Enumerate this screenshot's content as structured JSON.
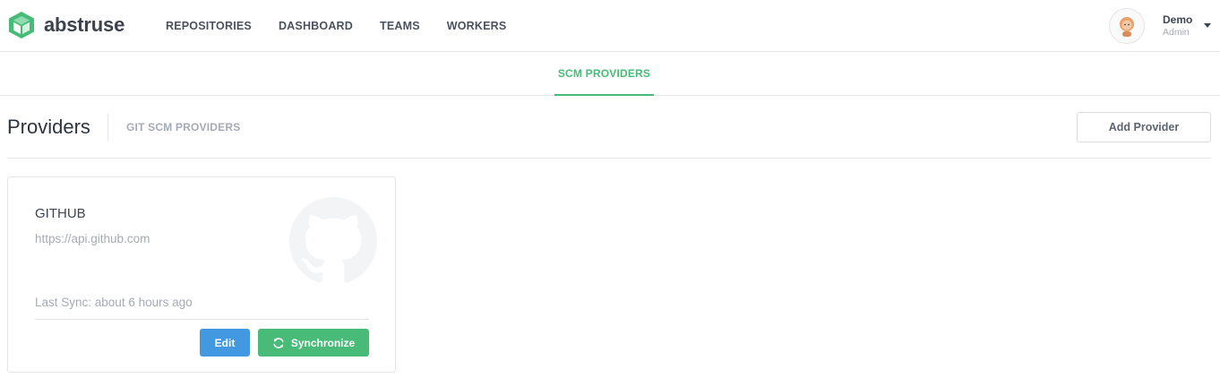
{
  "brand": {
    "name": "abstruse",
    "logo_icon": "cube-logo-icon",
    "color": "#48bb78"
  },
  "nav": {
    "items": [
      {
        "label": "REPOSITORIES"
      },
      {
        "label": "DASHBOARD"
      },
      {
        "label": "TEAMS"
      },
      {
        "label": "WORKERS"
      }
    ]
  },
  "user": {
    "name": "Demo",
    "role": "Admin",
    "avatar_icon": "avatar-icon",
    "menu_icon": "caret-down-icon"
  },
  "subnav": {
    "active_tab": "SCM PROVIDERS",
    "accent": "#48bb78"
  },
  "page": {
    "title": "Providers",
    "subtitle": "GIT SCM PROVIDERS",
    "add_button": "Add Provider"
  },
  "providers": [
    {
      "name": "GITHUB",
      "url": "https://api.github.com",
      "last_sync": "Last Sync: about 6 hours ago",
      "logo_icon": "github-logo-icon",
      "edit_label": "Edit",
      "sync_label": "Synchronize",
      "sync_icon": "refresh-icon"
    }
  ],
  "colors": {
    "primary": "#4299e1",
    "success": "#48bb78",
    "muted": "#a4abb5"
  }
}
